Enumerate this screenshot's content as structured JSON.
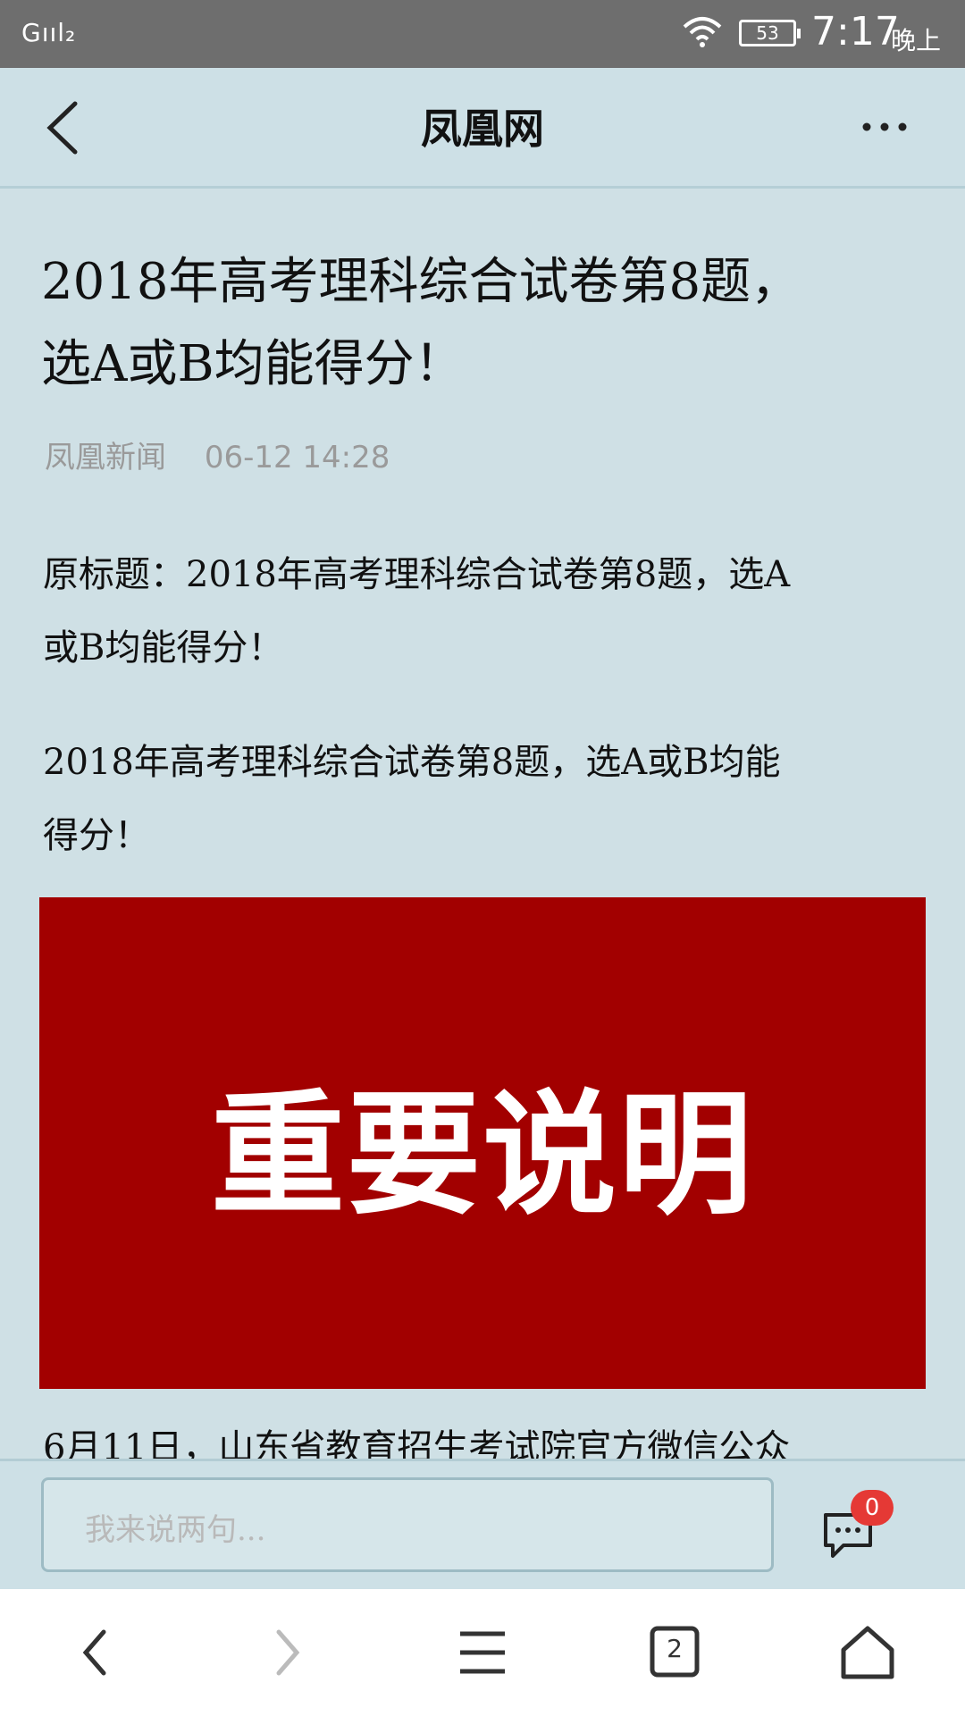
{
  "status_bar": {
    "signal": "Gııl₂",
    "battery": "53",
    "time": "7:17",
    "period": "晚上"
  },
  "header": {
    "title": "凤凰网",
    "back_icon": "chevron-left-icon",
    "more_icon": "more-dots-icon"
  },
  "article": {
    "title_line1": "2018年高考理科综合试卷第8题，",
    "title_line2": "选A或B均能得分！",
    "source": "凤凰新闻",
    "datetime": "06-12 14:28",
    "para1_line1": "原标题：2018年高考理科综合试卷第8题，选A",
    "para1_line2": "或B均能得分！",
    "para2_line1": "2018年高考理科综合试卷第8题，选A或B均能",
    "para2_line2": "得分！",
    "banner_text": "重要说明",
    "banner_color": "#a20000",
    "para3_partial": "6月11日，山东省教育招生考试院官方微信公众"
  },
  "comment_bar": {
    "placeholder": "我来说两句...",
    "badge_count": "0"
  },
  "bottom_nav": {
    "icons": [
      "back-arrow-icon",
      "forward-arrow-icon",
      "menu-icon",
      "tabs-icon",
      "home-icon"
    ],
    "tab_count": "2"
  }
}
